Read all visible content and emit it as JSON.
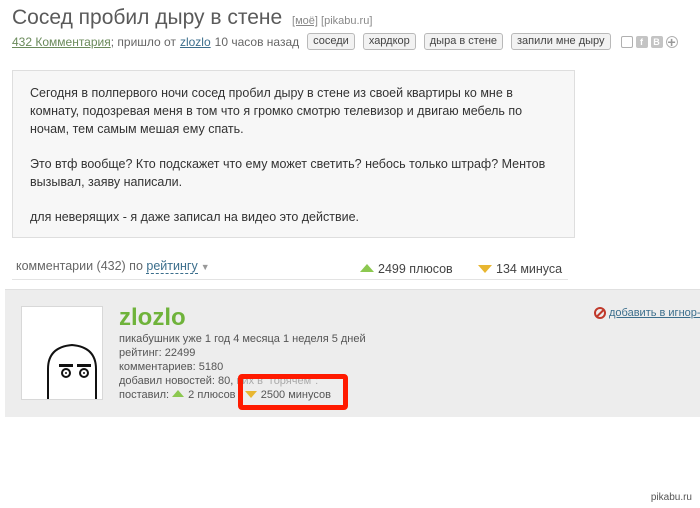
{
  "post": {
    "title": "Сосед пробил дыру в стене",
    "mine_label": "[моё]",
    "source_label": "[pikabu.ru]",
    "comments_link": "432 Комментария",
    "posted_prefix": "; пришло от",
    "author": "zlozlo",
    "time_ago": "10 часов назад",
    "tags": [
      "соседи",
      "хардкор",
      "дыра в стене",
      "запили мне дыру"
    ],
    "body": [
      "Сегодня в полпервого ночи сосед пробил дыру в стене из своей квартиры ко мне в комнату, подозревая меня в том что я громко смотрю телевизор и двигаю мебель по ночам, тем самым мешая ему спать.",
      "Это втф вообще? Кто подскажет что ему может светить? небось только штраф? Ментов вызывал, заяву написали.",
      "для неверящих - я даже записал на видео это действие."
    ]
  },
  "comments_bar": {
    "label": "комментарии (432) по",
    "sort_link": "рейтингу",
    "pluses": "2499 плюсов",
    "minuses": "134 минуса"
  },
  "profile": {
    "username": "zlozlo",
    "line1": "пикабушник уже 1 год 4 месяца 1 неделя 5 дней",
    "line2": "рейтинг: 22499",
    "line3": "комментариев: 5180",
    "line4_a": "добавил новостей: 80,",
    "line4_b": "них в \"горячем\": ",
    "line5_label": "поставил:",
    "given_pluses": "2 плюсов",
    "given_minuses": "2500 минусов",
    "ignore_link": "добавить в игнор-ли"
  },
  "colors": {
    "username": "#6fb33b",
    "plus_triangle": "#8cc850",
    "minus_triangle": "#e8b630",
    "highlight": "#ff1a00",
    "link": "#3b6e8c"
  },
  "watermark": "pikabu.ru"
}
